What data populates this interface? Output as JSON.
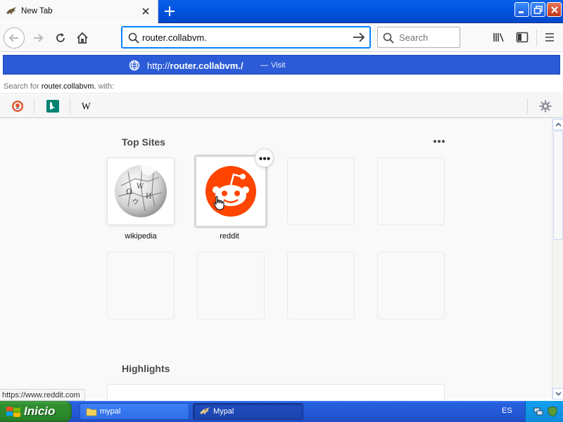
{
  "colors": {
    "accent": "#0a84ff",
    "popup_highlight": "#2b5bd7",
    "reddit": "#ff4500",
    "taskbar": "#2459d6",
    "start": "#2f8f2f"
  },
  "window": {
    "tab_title": "New Tab",
    "tab_icon": "mypal-bird-icon"
  },
  "navbar": {
    "url_value": "router.collabvm.",
    "search_placeholder": "Search"
  },
  "urlbar_popup": {
    "row": {
      "url_prefix": "http://",
      "url_host": "router.collabvm./",
      "separator": "—",
      "action": "Visit"
    },
    "search_for_prefix": "Search for",
    "search_for_term": "router.collabvm.",
    "search_for_suffix": "with:",
    "engines": [
      {
        "name": "duckduckgo-icon"
      },
      {
        "name": "bing-icon"
      },
      {
        "name": "wikipedia-icon",
        "glyph": "W"
      }
    ]
  },
  "content": {
    "top_sites_title": "Top Sites",
    "highlights_title": "Highlights",
    "tiles": [
      {
        "label": "wikipedia"
      },
      {
        "label": "reddit"
      }
    ]
  },
  "status_link": "https://www.reddit.com",
  "taskbar": {
    "start_label": "Inicio",
    "tasks": [
      {
        "label": "mypal"
      },
      {
        "label": "Mypal"
      }
    ],
    "language": "ES"
  }
}
